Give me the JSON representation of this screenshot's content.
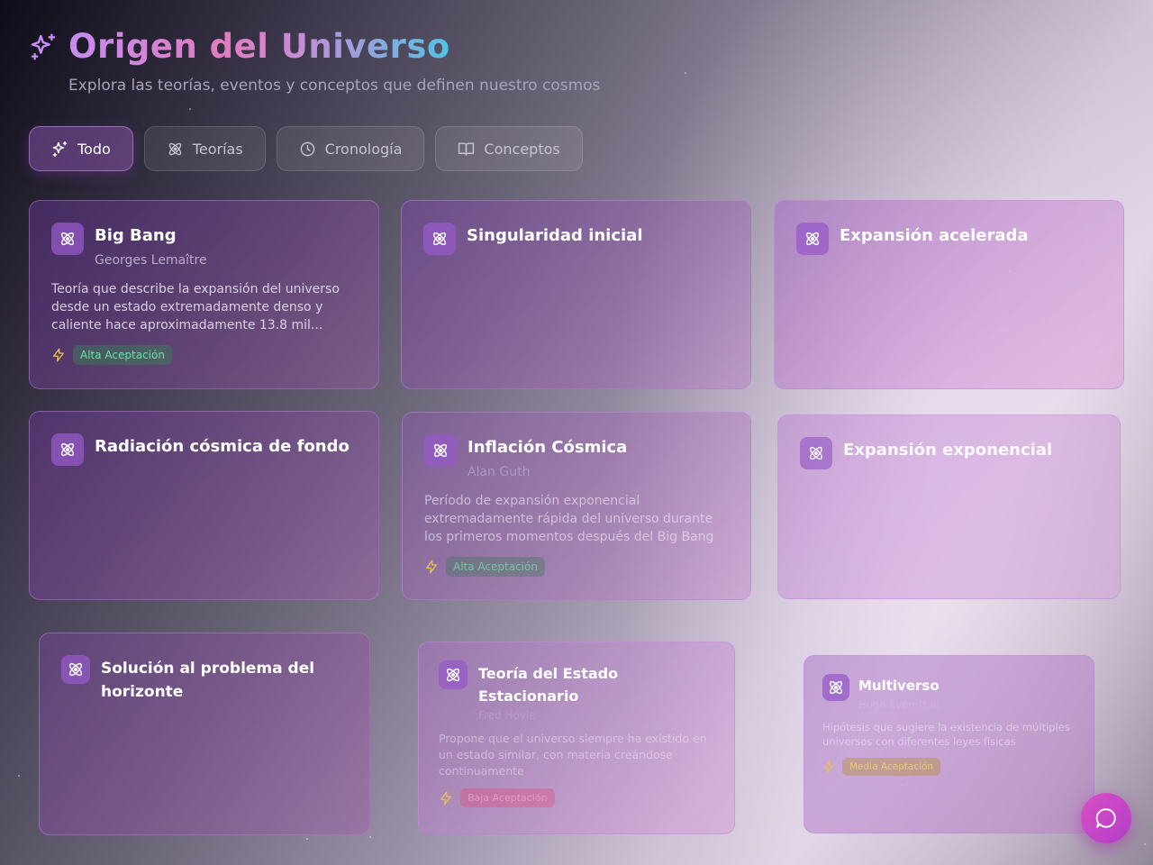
{
  "header": {
    "title": "Origen del Universo",
    "subtitle": "Explora las teorías, eventos y conceptos que definen nuestro cosmos",
    "icon": "sparkles-icon"
  },
  "tabs": [
    {
      "label": "Todo",
      "icon": "sparkles-icon",
      "active": true
    },
    {
      "label": "Teorías",
      "icon": "atom-icon",
      "active": false
    },
    {
      "label": "Cronología",
      "icon": "clock-icon",
      "active": false
    },
    {
      "label": "Conceptos",
      "icon": "book-icon",
      "active": false
    }
  ],
  "cards": [
    {
      "title": "Big Bang",
      "author": "Georges Lemaître",
      "description": "Teoría que describe la expansión del universo desde un estado extremadamente denso y caliente hace aproximadamente 13.8 mil...",
      "badge": "Alta Aceptación",
      "badge_color": "#6fe0a6"
    },
    {
      "title": "Singularidad inicial"
    },
    {
      "title": "Expansión acelerada"
    },
    {
      "title": "Radiación cósmica de fondo"
    },
    {
      "title": "Inflación Cósmica",
      "author": "Alan Guth",
      "description": "Período de expansión exponencial extremadamente rápida del universo durante los primeros momentos después del Big Bang",
      "badge": "Alta Aceptación",
      "badge_color": "#6fe0a6"
    },
    {
      "title": "Expansión exponencial"
    },
    {
      "title": "Solución al problema del horizonte"
    },
    {
      "title": "Teoría del Estado Estacionario",
      "author": "Fred Hoyle",
      "description": "Propone que el universo siempre ha existido en un estado similar, con materia creándose continuamente",
      "badge": "Baja Aceptación",
      "badge_color": "#ff9fc3"
    },
    {
      "title": "Multiverso",
      "author": "Hugh Everett III",
      "description": "Hipótesis que sugiere la existencia de múltiples universos con diferentes leyes físicas",
      "badge": "Media Aceptación",
      "badge_color": "#f5d36a"
    }
  ],
  "chat_button": {
    "icon": "chat-icon"
  },
  "colors": {
    "accent": "#d94fc4",
    "card_icon_bg": "#9a5ac8"
  }
}
